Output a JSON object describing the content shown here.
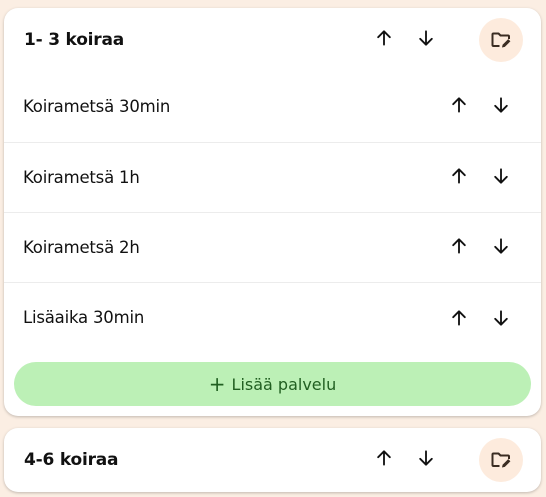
{
  "categories": [
    {
      "title": "1- 3 koiraa",
      "edit_icon": "folder-edit-icon",
      "services": [
        {
          "name": "Koirametsä 30min"
        },
        {
          "name": "Koirametsä 1h"
        },
        {
          "name": "Koirametsä 2h"
        },
        {
          "name": "Lisäaika 30min"
        }
      ],
      "add_service_label": "Lisää palvelu"
    },
    {
      "title": "4-6 koiraa",
      "edit_icon": "folder-edit-icon"
    }
  ],
  "icons": {
    "move_up": "arrow-up-icon",
    "move_down": "arrow-down-icon",
    "add": "plus-icon"
  },
  "colors": {
    "page_background": "#fbeee3",
    "edit_button_background": "#fdebdd",
    "add_button_background": "#bcf0b6",
    "add_button_text": "#215f21"
  }
}
